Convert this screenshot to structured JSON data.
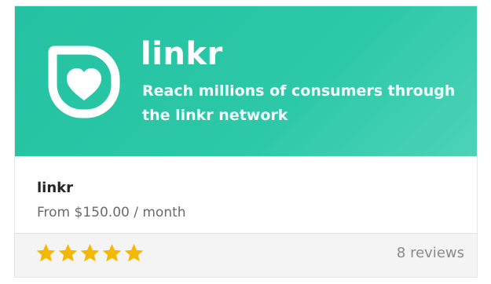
{
  "banner": {
    "brand_name": "linkr",
    "tagline": "Reach millions of consumers through the linkr network",
    "logo_icon": "heart-shield-icon",
    "color": "#24c2a2"
  },
  "product": {
    "name": "linkr",
    "price": "From $150.00 / month"
  },
  "rating": {
    "stars": 5,
    "max_stars": 5,
    "star_color": "#f5b800",
    "reviews_label": "8 reviews"
  }
}
